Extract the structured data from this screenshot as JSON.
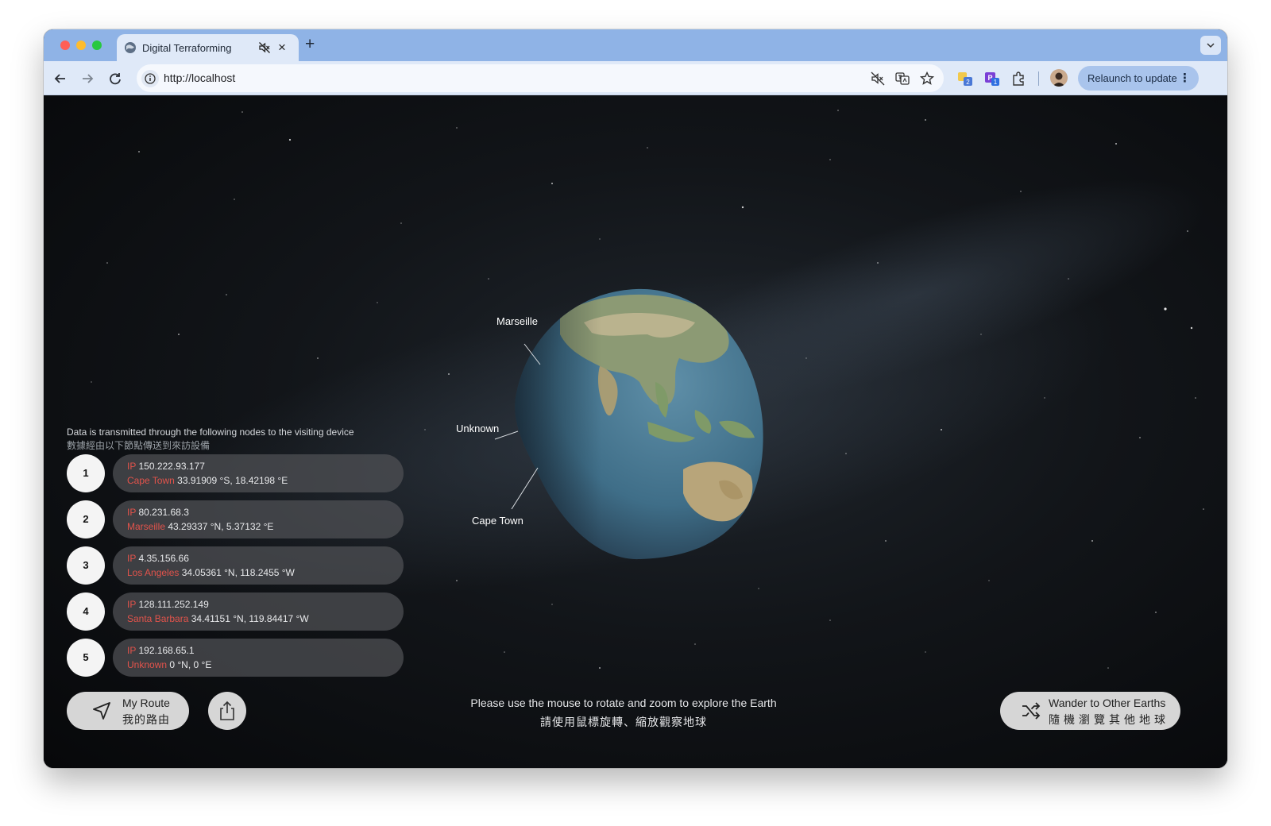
{
  "browser": {
    "tab_title": "Digital Terraforming",
    "url": "http://localhost",
    "relaunch_label": "Relaunch to update",
    "extensions": [
      {
        "name": "translate-extension-icon",
        "badge": "2"
      },
      {
        "name": "purple-extension-icon",
        "badge": "1"
      }
    ]
  },
  "globe": {
    "labels": {
      "marseille": "Marseille",
      "unknown": "Unknown",
      "cape_town": "Cape Town"
    }
  },
  "panel": {
    "title_en": "Data is transmitted through the following nodes to the visiting device",
    "title_zh": "數據經由以下節點傳送到來訪設備",
    "ip_label": "IP",
    "nodes": [
      {
        "num": "1",
        "ip": "150.222.93.177",
        "city": "Cape Town",
        "coords": "33.91909 °S, 18.42198 °E"
      },
      {
        "num": "2",
        "ip": "80.231.68.3",
        "city": "Marseille",
        "coords": "43.29337 °N, 5.37132 °E"
      },
      {
        "num": "3",
        "ip": "4.35.156.66",
        "city": "Los Angeles",
        "coords": "34.05361 °N, 118.2455 °W"
      },
      {
        "num": "4",
        "ip": "128.111.252.149",
        "city": "Santa Barbara",
        "coords": "34.41151 °N, 119.84417 °W"
      },
      {
        "num": "5",
        "ip": "192.168.65.1",
        "city": "Unknown",
        "coords": "0 °N, 0 °E"
      }
    ]
  },
  "controls": {
    "route_en": "My Route",
    "route_zh": "我的路由",
    "hint_en": "Please use the mouse to rotate and zoom to explore the Earth",
    "hint_zh": "請使用鼠標旋轉、縮放觀察地球",
    "wander_en": "Wander to Other Earths",
    "wander_zh": "隨機瀏覽其他地球"
  },
  "colors": {
    "accent_red": "#e2534b",
    "tab_strip": "#8fb3e6",
    "toolbar": "#dfe9f8"
  }
}
